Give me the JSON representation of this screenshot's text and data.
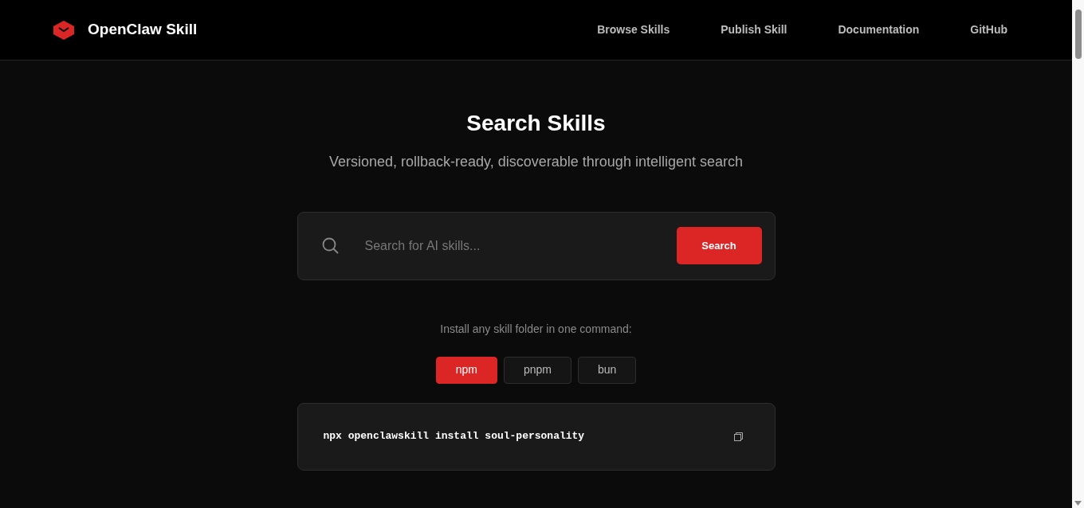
{
  "brand": {
    "name": "OpenClaw Skill"
  },
  "nav": [
    {
      "label": "Browse Skills"
    },
    {
      "label": "Publish Skill"
    },
    {
      "label": "Documentation"
    },
    {
      "label": "GitHub"
    }
  ],
  "hero": {
    "title": "Search Skills",
    "subtitle": "Versioned, rollback-ready, discoverable through intelligent search"
  },
  "search": {
    "placeholder": "Search for AI skills...",
    "button": "Search"
  },
  "install": {
    "label": "Install any skill folder in one command:",
    "tabs": [
      {
        "label": "npm",
        "selected": true
      },
      {
        "label": "pnpm",
        "selected": false
      },
      {
        "label": "bun",
        "selected": false
      }
    ],
    "command": "npx openclawskill install soul-personality"
  }
}
